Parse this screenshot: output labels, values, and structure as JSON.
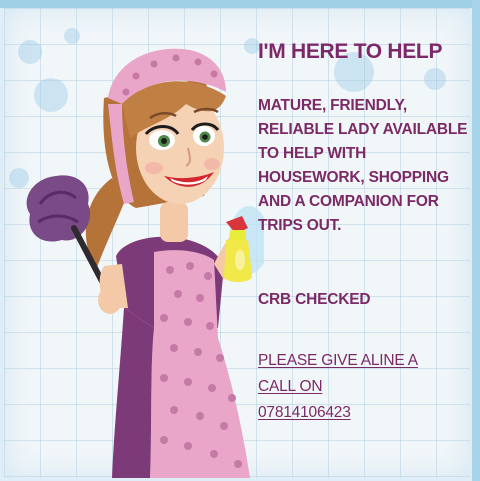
{
  "flyer": {
    "headline": "I'M HERE TO HELP",
    "description": "MATURE, FRIENDLY, RELIABLE LADY AVAILABLE TO HELP WITH HOUSEWORK, SHOPPING AND A COMPANION FOR TRIPS OUT.",
    "crb": "CRB CHECKED",
    "call_line1": "PLEASE GIVE ALINE A",
    "call_line2": "CALL ON",
    "phone": "07814106423"
  },
  "colors": {
    "text": "#7b2a66",
    "background": "#f1f6f9",
    "apron": "#e9a6c8",
    "dress": "#7d3a78",
    "hair": "#b5733a"
  },
  "icons": [
    "cleaning-lady-illustration",
    "feather-duster-icon",
    "spray-bottle-icon"
  ]
}
